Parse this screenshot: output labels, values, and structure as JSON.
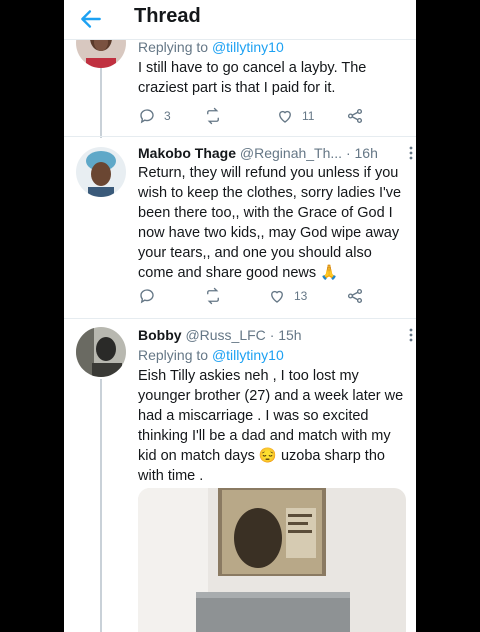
{
  "header": {
    "title": "Thread"
  },
  "tweets": [
    {
      "replying_prefix": "Replying to ",
      "replying_handle": "@tillytiny10",
      "text": "I still have to go cancel a layby. The craziest part is that I paid for it.",
      "replies": "3",
      "retweets": "",
      "likes": "11"
    },
    {
      "name": "Makobo Thage",
      "handle": "@Reginah_Th...",
      "time": "· 16h",
      "text": "Return, they will refund you unless if you wish to keep the clothes, sorry ladies I've been there too,, with the Grace of God I now have two kids,, may God wipe away your tears,, and one you should also come and share good news 🙏",
      "replies": "",
      "retweets": "",
      "likes": "13"
    },
    {
      "name": "Bobby",
      "handle": "@Russ_LFC",
      "time": "· 15h",
      "replying_prefix": "Replying to ",
      "replying_handle": "@tillytiny10",
      "text": "Eish Tilly askies neh , I too lost my younger brother (27) and a week later we had a miscarriage . I was so excited thinking I'll be a dad and match with my kid on match days 😔 uzoba sharp tho with time ."
    }
  ],
  "icons": {
    "back": "back-arrow-icon",
    "reply": "reply-icon",
    "retweet": "retweet-icon",
    "like": "heart-icon",
    "share": "share-icon",
    "more": "more-vertical-icon"
  },
  "colors": {
    "accent": "#1da1f2",
    "secondary_text": "#657786",
    "divider": "#e6ecf0",
    "thread_line": "#c9d1d8"
  }
}
